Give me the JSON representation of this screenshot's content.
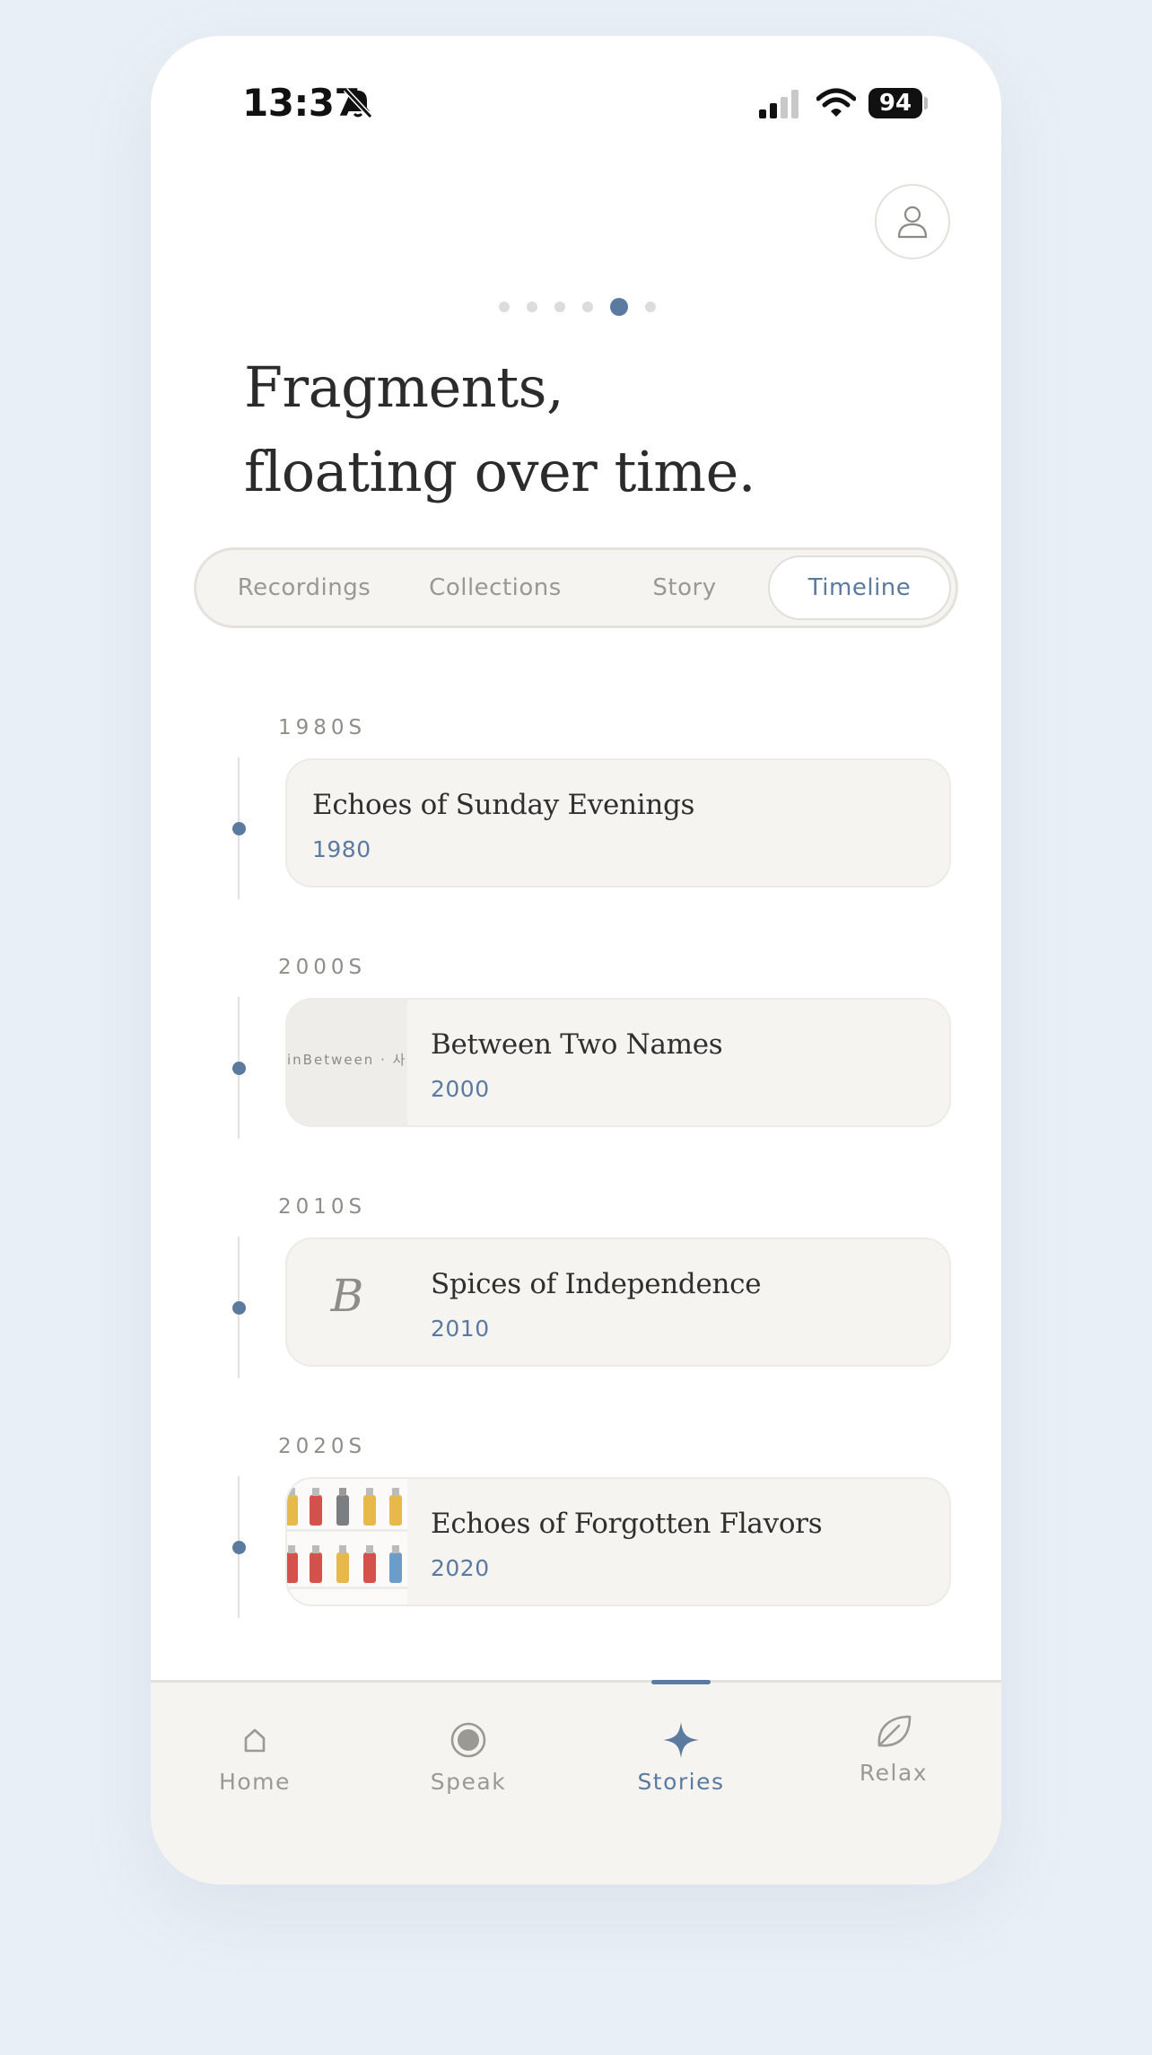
{
  "status_bar": {
    "time": "13:37",
    "battery": "94"
  },
  "pager": {
    "count": 6,
    "active_index": 4
  },
  "headline": {
    "line1": "Fragments,",
    "line2": "floating over time."
  },
  "tabs": [
    {
      "label": "Recordings",
      "active": false
    },
    {
      "label": "Collections",
      "active": false
    },
    {
      "label": "Story",
      "active": false
    },
    {
      "label": "Timeline",
      "active": true
    }
  ],
  "timeline": [
    {
      "decade": "1980S",
      "title": "Echoes of Sunday Evenings",
      "year": "1980",
      "thumb": null
    },
    {
      "decade": "2000S",
      "title": "Between Two Names",
      "year": "2000",
      "thumb": "inBetween · 사이"
    },
    {
      "decade": "2010S",
      "title": "Spices of Independence",
      "year": "2010",
      "thumb": "B"
    },
    {
      "decade": "2020S",
      "title": "Echoes of Forgotten Flavors",
      "year": "2020",
      "thumb": "bottles-grid"
    }
  ],
  "nav": {
    "items": [
      {
        "label": "Home",
        "icon": "home-icon",
        "active": false
      },
      {
        "label": "Speak",
        "icon": "record-icon",
        "active": false
      },
      {
        "label": "Stories",
        "icon": "sparkle-icon",
        "active": true
      },
      {
        "label": "Relax",
        "icon": "leaf-icon",
        "active": false
      }
    ]
  },
  "colors": {
    "accent": "#5b7aa0",
    "card_bg": "#f5f4f1",
    "page_bg": "#e9eff6"
  }
}
